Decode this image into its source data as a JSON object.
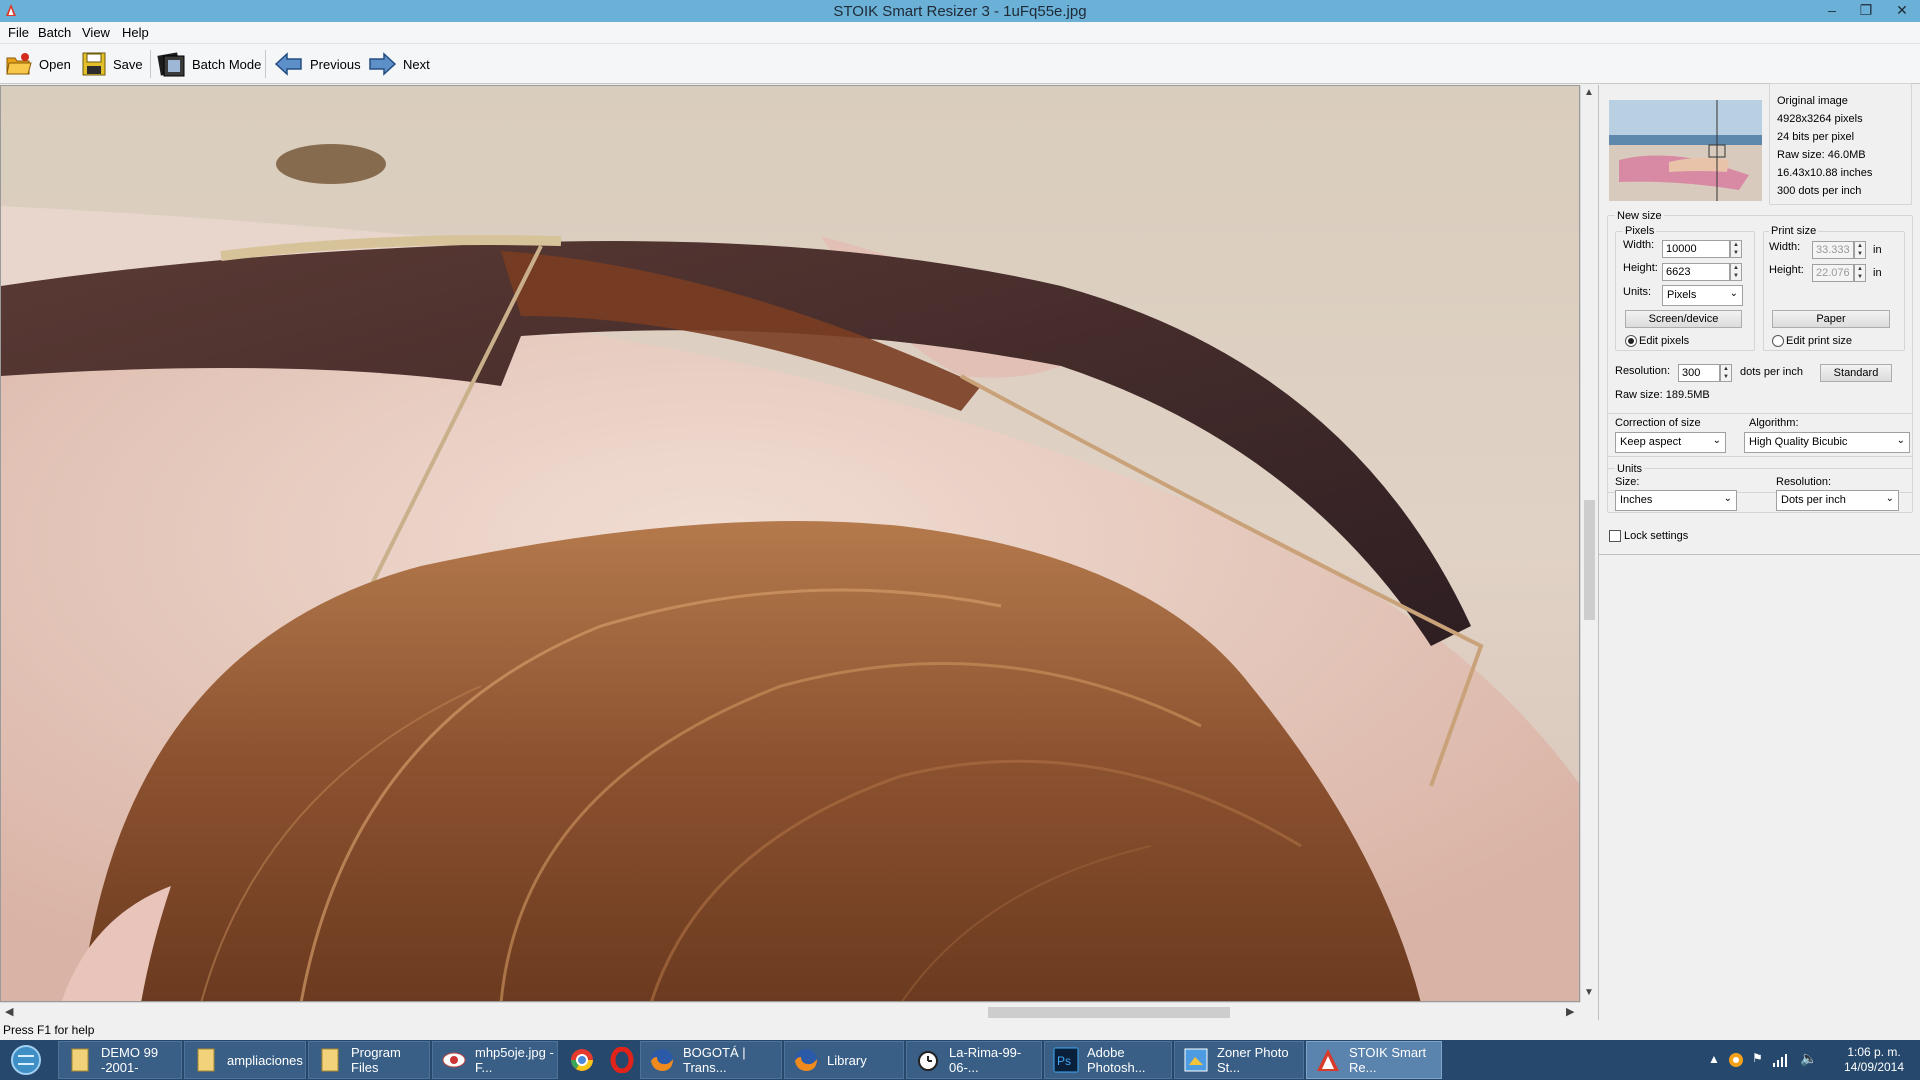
{
  "window": {
    "title": "STOIK Smart Resizer 3 - 1uFq55e.jpg",
    "minimize": "–",
    "maximize": "❐",
    "close": "✕"
  },
  "menu": [
    "File",
    "Batch",
    "View",
    "Help"
  ],
  "toolbar": {
    "open": "Open",
    "save": "Save",
    "batch_mode": "Batch Mode",
    "previous": "Previous",
    "next": "Next"
  },
  "original_image": {
    "title": "Original image",
    "pixels": "4928x3264 pixels",
    "bits": "24 bits per pixel",
    "raw_size": "Raw size: 46.0MB",
    "inches": "16.43x10.88 inches",
    "dpi": "300 dots per inch"
  },
  "new_size": {
    "title": "New size",
    "pixels_title": "Pixels",
    "width_label": "Width:",
    "width_value": "10000",
    "height_label": "Height:",
    "height_value": "6623",
    "units_label": "Units:",
    "units_value": "Pixels",
    "screen_button": "Screen/device",
    "edit_pixels": "Edit pixels",
    "print_title": "Print size",
    "print_width_label": "Width:",
    "print_width_value": "33.333",
    "print_height_label": "Height:",
    "print_height_value": "22.076",
    "in_unit": "in",
    "paper_button": "Paper",
    "edit_print_size": "Edit print size",
    "resolution_label": "Resolution:",
    "resolution_value": "300",
    "dpi_label": "dots per inch",
    "standard_button": "Standard",
    "raw_size": "Raw size: 189.5MB"
  },
  "correction": {
    "label": "Correction of size",
    "value": "Keep aspect"
  },
  "algorithm": {
    "label": "Algorithm:",
    "value": "High Quality Bicubic"
  },
  "units": {
    "title": "Units",
    "size_label": "Size:",
    "size_value": "Inches",
    "resolution_label": "Resolution:",
    "resolution_value": "Dots per inch"
  },
  "lock_settings": "Lock settings",
  "status": "Press F1 for help",
  "taskbar": {
    "items": [
      "DEMO 99 -2001-",
      "ampliaciones",
      "Program Files",
      "mhp5oje.jpg - F...",
      "BOGOTÁ | Trans...",
      "Library",
      "La-Rima-99-06-...",
      "Adobe Photosh...",
      "Zoner Photo St...",
      "STOIK Smart Re..."
    ],
    "time": "1:06 p. m.",
    "date": "14/09/2014"
  }
}
